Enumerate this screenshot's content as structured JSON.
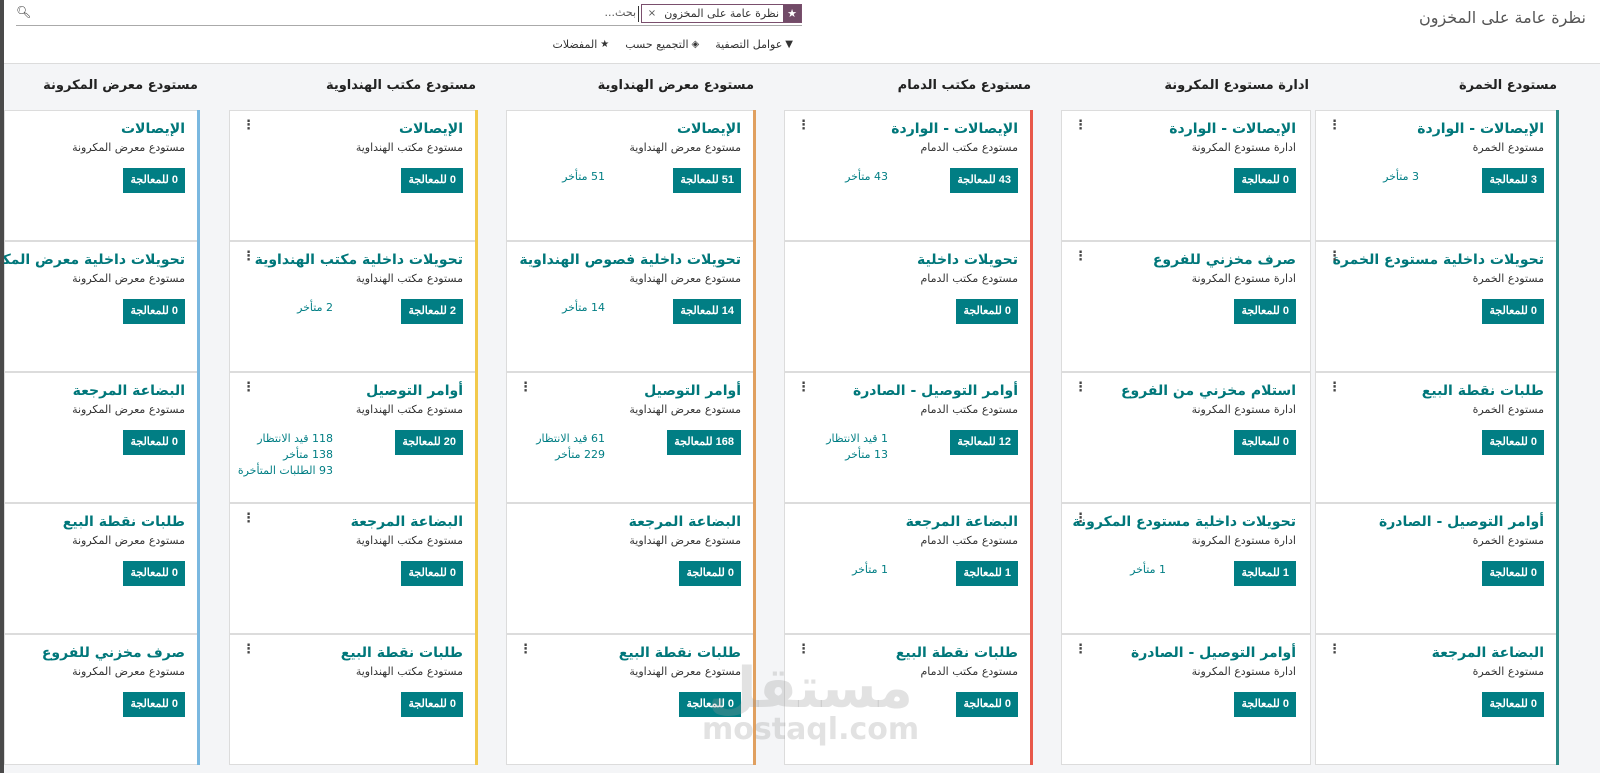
{
  "breadcrumb": "نظرة عامة على المخزون",
  "search": {
    "placeholder": "بحث...",
    "facet_label": "نظرة عامة على المخزون",
    "facet_remove": "×"
  },
  "filters": {
    "filters_label": "عوامل التصفية",
    "groupby_label": "التجميع حسب",
    "favorites_label": "المفضلات"
  },
  "colors": {
    "primary": "#017e84",
    "title": "#00777a",
    "facet": "#714b67"
  },
  "labels": {
    "to_process_suffix": "للمعالجة",
    "waiting": "قيد الانتظار",
    "late": "متأخر",
    "backorders": "الطلبات المتأخرة"
  },
  "columns": [
    {
      "title": "مستودع الخمرة",
      "bar_color": "#2b8a86",
      "cards": [
        {
          "name": "الإيصالات - الواردة",
          "warehouse": "مستودع الخمرة",
          "button": "3 للمعالجة",
          "stats": [
            "3 متأخر"
          ]
        },
        {
          "name": "تحويلات داخلية مستودع الخمرة",
          "warehouse": "مستودع الخمرة",
          "button": "0 للمعالجة",
          "stats": []
        },
        {
          "name": "طلبات نقطة البيع",
          "warehouse": "مستودع الخمرة",
          "button": "0 للمعالجة",
          "stats": []
        },
        {
          "name": "أوامر التوصيل - الصادرة",
          "warehouse": "مستودع الخمرة",
          "button": "0 للمعالجة",
          "stats": []
        },
        {
          "name": "البضاعة المرجعة",
          "warehouse": "مستودع الخمرة",
          "button": "0 للمعالجة",
          "stats": []
        }
      ]
    },
    {
      "title": "ادارة مستودع المكرونة",
      "bar_color": "",
      "cards": [
        {
          "name": "الإيصالات - الواردة",
          "warehouse": "ادارة مستودع المكرونة",
          "button": "0 للمعالجة",
          "stats": []
        },
        {
          "name": "صرف مخزني للفروع",
          "warehouse": "ادارة مستودع المكرونة",
          "button": "0 للمعالجة",
          "stats": []
        },
        {
          "name": "استلام مخزني من الفروع",
          "warehouse": "ادارة مستودع المكرونة",
          "button": "0 للمعالجة",
          "stats": []
        },
        {
          "name": "تحويلات داخلية مستودع المكرونة",
          "warehouse": "ادارة مستودع المكرونة",
          "button": "1 للمعالجة",
          "stats": [
            "1 متأخر"
          ]
        },
        {
          "name": "أوامر التوصيل - الصادرة",
          "warehouse": "ادارة مستودع المكرونة",
          "button": "0 للمعالجة",
          "stats": []
        }
      ]
    },
    {
      "title": "مستودع مكتب الدمام",
      "bar_color": "#e8584a",
      "cards": [
        {
          "name": "الإيصالات - الواردة",
          "warehouse": "مستودع مكتب الدمام",
          "button": "43 للمعالجة",
          "stats": [
            "43 متأخر"
          ]
        },
        {
          "name": "تحويلات داخلية",
          "warehouse": "مستودع مكتب الدمام",
          "button": "0 للمعالجة",
          "stats": []
        },
        {
          "name": "أوامر التوصيل - الصادرة",
          "warehouse": "مستودع مكتب الدمام",
          "button": "12 للمعالجة",
          "stats": [
            "1 قيد الانتظار",
            "13 متأخر"
          ]
        },
        {
          "name": "البضاعة المرجعة",
          "warehouse": "مستودع مكتب الدمام",
          "button": "1 للمعالجة",
          "stats": [
            "1 متأخر"
          ]
        },
        {
          "name": "طلبات نقطة البيع",
          "warehouse": "مستودع مكتب الدمام",
          "button": "0 للمعالجة",
          "stats": []
        }
      ]
    },
    {
      "title": "مستودع معرض الهنداوية",
      "bar_color": "#e0a060",
      "cards": [
        {
          "name": "الإيصالات",
          "warehouse": "مستودع معرض الهنداوية",
          "button": "51 للمعالجة",
          "stats": [
            "51 متأخر"
          ]
        },
        {
          "name": "تحويلات داخلية فصوص الهنداوية",
          "warehouse": "مستودع معرض الهنداوية",
          "button": "14 للمعالجة",
          "stats": [
            "14 متأخر"
          ]
        },
        {
          "name": "أوامر التوصيل",
          "warehouse": "مستودع معرض الهنداوية",
          "button": "168 للمعالجة",
          "stats": [
            "61 قيد الانتظار",
            "229 متأخر"
          ]
        },
        {
          "name": "البضاعة المرجعة",
          "warehouse": "مستودع معرض الهنداوية",
          "button": "0 للمعالجة",
          "stats": []
        },
        {
          "name": "طلبات نقطة البيع",
          "warehouse": "مستودع معرض الهنداوية",
          "button": "0 للمعالجة",
          "stats": []
        }
      ]
    },
    {
      "title": "مستودع مكتب الهنداوية",
      "bar_color": "#f2c94c",
      "cards": [
        {
          "name": "الإيصالات",
          "warehouse": "مستودع مكتب الهنداوية",
          "button": "0 للمعالجة",
          "stats": []
        },
        {
          "name": "تحويلات داخلية مكتب الهنداوية",
          "warehouse": "مستودع مكتب الهنداوية",
          "button": "2 للمعالجة",
          "stats": [
            "2 متأخر"
          ]
        },
        {
          "name": "أوامر التوصيل",
          "warehouse": "مستودع مكتب الهنداوية",
          "button": "20 للمعالجة",
          "stats": [
            "118 قيد الانتظار",
            "138 متأخر",
            "93 الطلبات المتأخرة"
          ]
        },
        {
          "name": "البضاعة المرجعة",
          "warehouse": "مستودع مكتب الهنداوية",
          "button": "0 للمعالجة",
          "stats": []
        },
        {
          "name": "طلبات نقطة البيع",
          "warehouse": "مستودع مكتب الهنداوية",
          "button": "0 للمعالجة",
          "stats": []
        }
      ]
    },
    {
      "title": "مستودع معرض المكرونة",
      "bar_color": "#7ab8e0",
      "cards": [
        {
          "name": "الإيصالات",
          "warehouse": "مستودع معرض المكرونة",
          "button": "0 للمعالجة",
          "stats": []
        },
        {
          "name": "تحويلات داخلية معرض المكرونة",
          "warehouse": "مستودع معرض المكرونة",
          "button": "0 للمعالجة",
          "stats": []
        },
        {
          "name": "البضاعة المرجعة",
          "warehouse": "مستودع معرض المكرونة",
          "button": "0 للمعالجة",
          "stats": []
        },
        {
          "name": "طلبات نقطة البيع",
          "warehouse": "مستودع معرض المكرونة",
          "button": "0 للمعالجة",
          "stats": []
        },
        {
          "name": "صرف مخزني للفروع",
          "warehouse": "مستودع معرض المكرونة",
          "button": "0 للمعالجة",
          "stats": []
        }
      ]
    }
  ],
  "watermark": {
    "arabic": "مستقل",
    "latin": "mostaql.com"
  }
}
